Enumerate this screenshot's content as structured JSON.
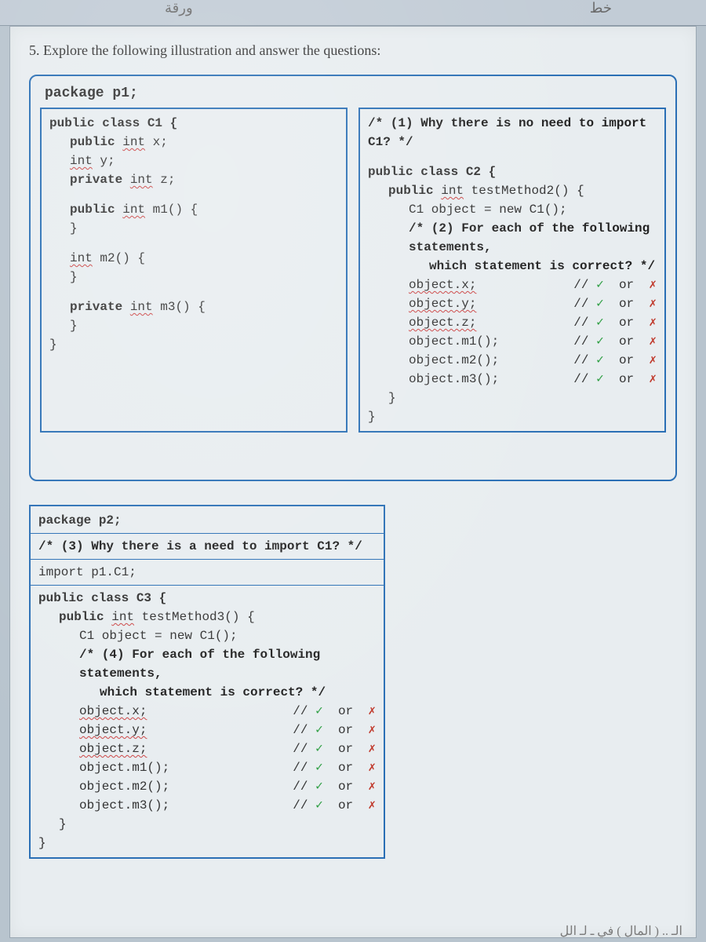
{
  "header": {
    "scriptLeft": "ورقة",
    "scriptRight": "خط"
  },
  "question": "5. Explore the following illustration and answer the questions:",
  "frame1": {
    "pkg": "package p1;",
    "c1": {
      "l1": "public class C1 {",
      "l2": "public",
      "l2b": "int",
      "l2c": " x;",
      "l3a": "int",
      "l3b": " y;",
      "l4": "private ",
      "l4b": "int",
      "l4c": " z;",
      "l5a": "public ",
      "l5b": "int",
      "l5c": " m1() {",
      "l6": "}",
      "l7a": "int",
      "l7b": " m2()  {",
      "l8": "}",
      "l9a": "private ",
      "l9b": "int",
      "l9c": " m3() {",
      "l10": "}",
      "l11": "}"
    },
    "c2": {
      "q1": "/* (1) Why there is no need to import C1? */",
      "l1": "public class C2 {",
      "l2a": "public ",
      "l2b": "int",
      "l2c": " testMethod2() {",
      "l3": "C1 object = new C1();",
      "q2a": "/* (2) For each of the following statements,",
      "q2b": "which statement is correct? */",
      "s1": "object.x;",
      "s2": "object.y;",
      "s3": "object.z;",
      "s4": "object.m1();",
      "s5": "object.m2();",
      "s6": "object.m3();",
      "close1": "}",
      "close2": "}",
      "orLabel": "or"
    }
  },
  "frame2": {
    "pkg": "package p2;",
    "q3": "/* (3) Why there is a need to import C1? */",
    "imp": "import p1.C1;",
    "l1": "public class C3 {",
    "l2a": "public ",
    "l2b": "int",
    "l2c": " testMethod3() {",
    "l3": "C1 object = new C1();",
    "q4a": "/* (4) For each of the following statements,",
    "q4b": "which statement is correct? */",
    "s1": "object.x;",
    "s2": "object.y;",
    "s3": "object.z;",
    "s4": "object.m1();",
    "s5": "object.m2();",
    "s6": "object.m3();",
    "close1": "}",
    "close2": "}",
    "orLabel": "or"
  },
  "marks": {
    "check": "✓",
    "cross": "✗",
    "slashes": "//"
  },
  "bottomScribble": "‫الـ .. ( المال ) في ـ لـ الل‬"
}
